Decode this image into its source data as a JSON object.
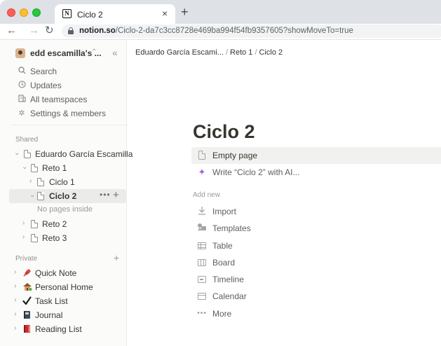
{
  "browser": {
    "tab_title": "Ciclo 2",
    "tab_close": "×",
    "new_tab": "+",
    "url_host": "notion.so",
    "url_path": "/Ciclo-2-da7c3cc8728e469ba994f54fb9357605?showMoveTo=true"
  },
  "sidebar": {
    "workspace_name": "edd escamilla's ...",
    "nav": [
      {
        "label": "Search",
        "icon": "search-icon"
      },
      {
        "label": "Updates",
        "icon": "clock-icon"
      },
      {
        "label": "All teamspaces",
        "icon": "building-icon"
      },
      {
        "label": "Settings & members",
        "icon": "gear-icon"
      }
    ],
    "shared_label": "Shared",
    "shared_tree": [
      {
        "label": "Eduardo García Escamilla"
      },
      {
        "label": "Reto 1"
      },
      {
        "label": "Ciclo 1"
      },
      {
        "label": "Ciclo 2"
      },
      {
        "label": "No pages inside"
      },
      {
        "label": "Reto 2"
      },
      {
        "label": "Reto 3"
      }
    ],
    "private_label": "Private",
    "private_items": [
      {
        "label": "Quick Note",
        "icon": "pushpin-icon"
      },
      {
        "label": "Personal Home",
        "icon": "house-icon"
      },
      {
        "label": "Task List",
        "icon": "checkmark-icon"
      },
      {
        "label": "Journal",
        "icon": "notebook-icon"
      },
      {
        "label": "Reading List",
        "icon": "red-book-icon"
      }
    ]
  },
  "breadcrumb": {
    "items": [
      "Eduardo García Escami...",
      "Reto 1",
      "Ciclo 2"
    ],
    "separator": "/"
  },
  "page": {
    "title": "Ciclo 2",
    "empty_page": "Empty page",
    "write_ai": "Write “Ciclo 2” with AI...",
    "add_new_label": "Add new",
    "add_new": [
      {
        "label": "Import",
        "icon": "import-icon"
      },
      {
        "label": "Templates",
        "icon": "templates-icon"
      },
      {
        "label": "Table",
        "icon": "table-icon"
      },
      {
        "label": "Board",
        "icon": "board-icon"
      },
      {
        "label": "Timeline",
        "icon": "timeline-icon"
      },
      {
        "label": "Calendar",
        "icon": "calendar-icon"
      },
      {
        "label": "More",
        "icon": "more-dots-icon"
      }
    ]
  },
  "colors": {
    "ai_accent": "#a066cf",
    "sidebar_bg": "#fbfbfa",
    "text": "#37352f"
  }
}
